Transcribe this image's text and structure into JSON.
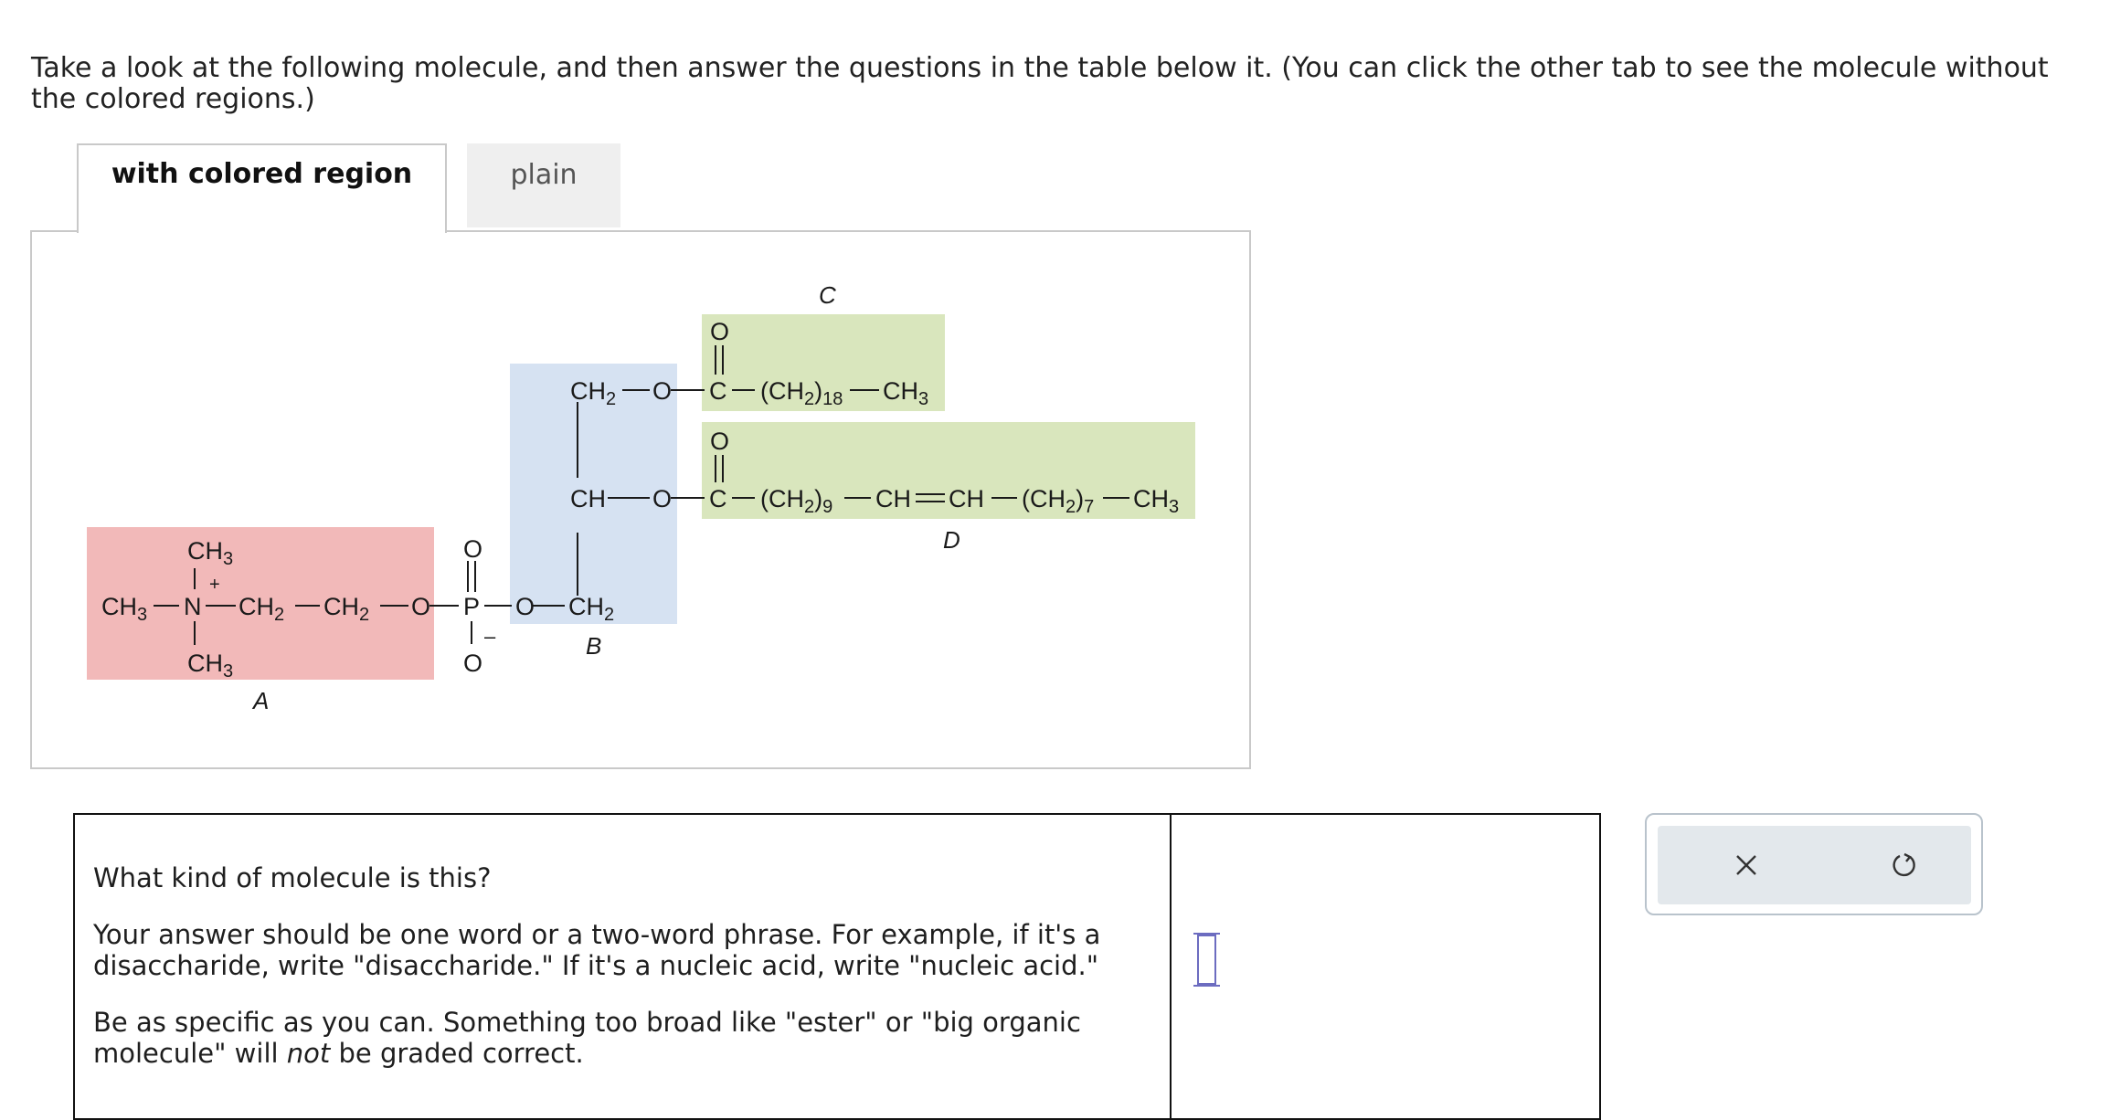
{
  "instructions": "Take a look at the following molecule, and then answer the questions in the table below it. (You can click the other tab to see the molecule without the colored regions.)",
  "tabs": {
    "colored": "with colored region",
    "plain": "plain"
  },
  "molecule": {
    "colors": {
      "A": "#f2b9b9",
      "B": "#d6e2f2",
      "C": "#d9e6bd",
      "D": "#d9e6bd"
    },
    "label_colors": {
      "A": "#c0392b",
      "B": "#3d6fb0",
      "C": "#2e7d4f",
      "D": "#2e7d4f"
    },
    "region_labels": {
      "A": "A",
      "B": "B",
      "C": "C",
      "D": "D"
    },
    "atoms": {
      "ch3": "CH",
      "ch2": "CH",
      "ch": "CH",
      "n": "N",
      "o": "O",
      "p": "P",
      "c": "C",
      "plus": "+",
      "minus": "–",
      "sub2": "2",
      "sub3": "3",
      "sub9": "9",
      "sub7": "7",
      "sub18": "18",
      "ch2_group": "(CH",
      "close": ")",
      "eq": "="
    }
  },
  "question": {
    "prompt": "What kind of molecule is this?",
    "hint": "Your answer should be one word or a two-word phrase. For example, if it's a disaccharide, write \"disaccharide.\" If it's a nucleic acid, write \"nucleic acid.\"",
    "note_prefix": "Be as specific as you can. Something too broad like \"ester\" or \"big organic molecule\" will ",
    "note_emph": "not",
    "note_suffix": " be graded correct.",
    "answer_value": ""
  },
  "actions": {
    "clear_icon": "close-icon",
    "reset_icon": "undo-icon"
  }
}
